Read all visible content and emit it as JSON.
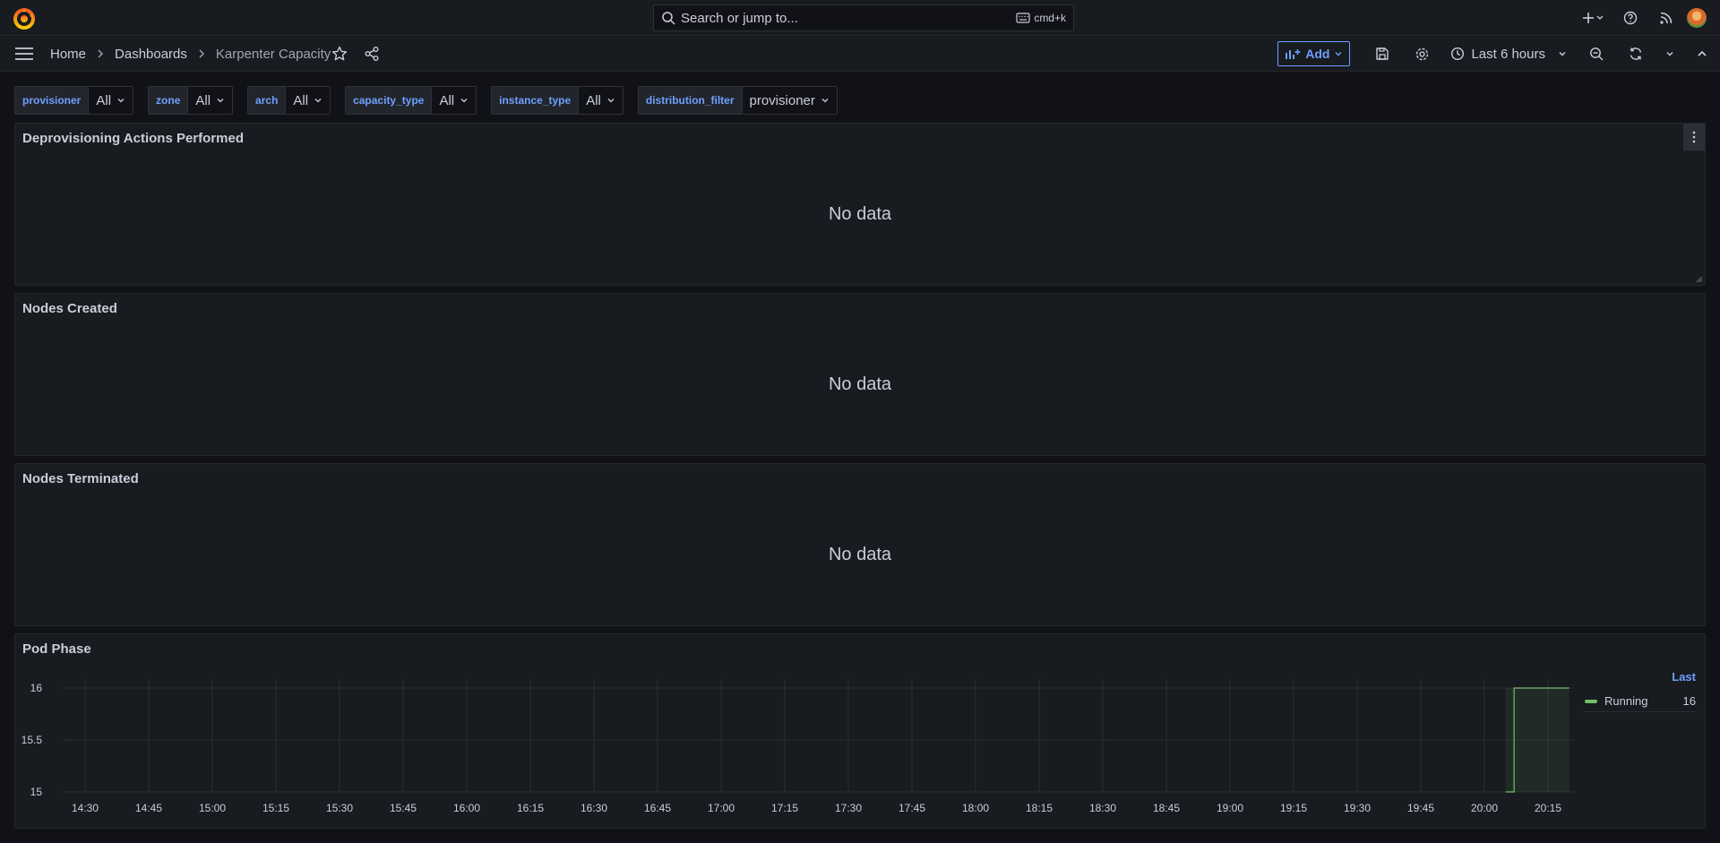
{
  "topbar": {
    "search_placeholder": "Search or jump to...",
    "shortcut": "cmd+k",
    "icons": [
      "grafana-logo-icon",
      "plus-icon",
      "help-icon",
      "news-icon",
      "avatar"
    ]
  },
  "breadcrumb": {
    "home": "Home",
    "dashboards": "Dashboards",
    "current": "Karpenter Capacity"
  },
  "toolbar": {
    "add_label": "Add",
    "time_range": "Last 6 hours"
  },
  "variables": [
    {
      "label": "provisioner",
      "value": "All"
    },
    {
      "label": "zone",
      "value": "All"
    },
    {
      "label": "arch",
      "value": "All"
    },
    {
      "label": "capacity_type",
      "value": "All"
    },
    {
      "label": "instance_type",
      "value": "All"
    },
    {
      "label": "distribution_filter",
      "value": "provisioner"
    }
  ],
  "panels": {
    "deprovisioning": {
      "title": "Deprovisioning Actions Performed",
      "empty": "No data"
    },
    "nodes_created": {
      "title": "Nodes Created",
      "empty": "No data"
    },
    "nodes_terminated": {
      "title": "Nodes Terminated",
      "empty": "No data"
    },
    "pod_phase": {
      "title": "Pod Phase",
      "legend_header": "Last",
      "legend": [
        {
          "name": "Running",
          "value": "16"
        }
      ]
    }
  },
  "colors": {
    "accent": "#6e9fff",
    "series_running": "#73bf69",
    "panel_bg": "#181b1f",
    "page_bg": "#111217"
  },
  "chart_data": {
    "type": "line",
    "title": "Pod Phase",
    "x": [
      "20:05",
      "20:06",
      "20:07",
      "20:20"
    ],
    "series": [
      {
        "name": "Running",
        "values": [
          15,
          15,
          16,
          16
        ]
      }
    ],
    "xticks": [
      "14:30",
      "14:45",
      "15:00",
      "15:15",
      "15:30",
      "15:45",
      "16:00",
      "16:15",
      "16:30",
      "16:45",
      "17:00",
      "17:15",
      "17:30",
      "17:45",
      "18:00",
      "18:15",
      "18:30",
      "18:45",
      "19:00",
      "19:15",
      "19:30",
      "19:45",
      "20:00",
      "20:15"
    ],
    "yticks": [
      "15",
      "15.5",
      "16"
    ],
    "ylim": [
      15,
      16
    ],
    "grid": true,
    "legend": "right"
  }
}
